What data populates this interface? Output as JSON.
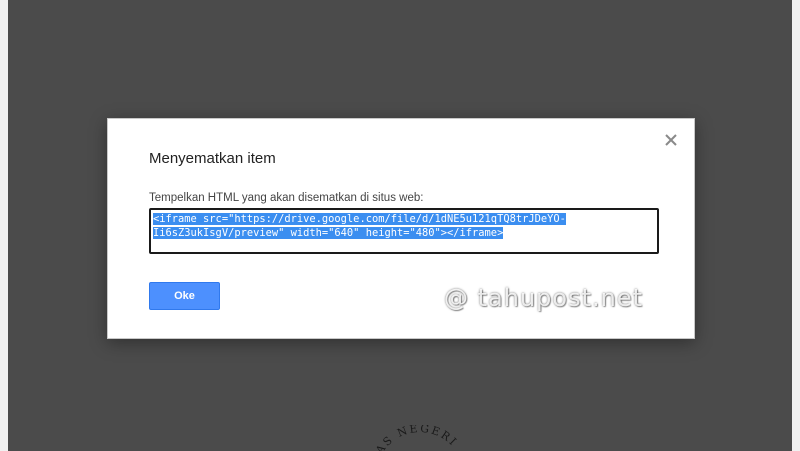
{
  "dialog": {
    "title": "Menyematkan item",
    "instruction": "Tempelkan HTML yang akan disematkan di situs web:",
    "embed_code_line1": "<iframe src=\"https://drive.google.com/file/d/1dNE5u121qTQ8trJDeYO-",
    "embed_code_line2": "Ii6sZ3ukIsgV/preview\" width=\"640\" height=\"480\"></iframe>",
    "ok_label": "Oke",
    "close_glyph": "×"
  },
  "background": {
    "seal_text": "AS NEGERI"
  },
  "watermark": {
    "text": "@ tahupost.net"
  },
  "colors": {
    "overlay": "#4b4b4b",
    "primary_button": "#4d90fe",
    "selection": "#3b8ef0"
  },
  "icons": {
    "close": "close-icon"
  }
}
